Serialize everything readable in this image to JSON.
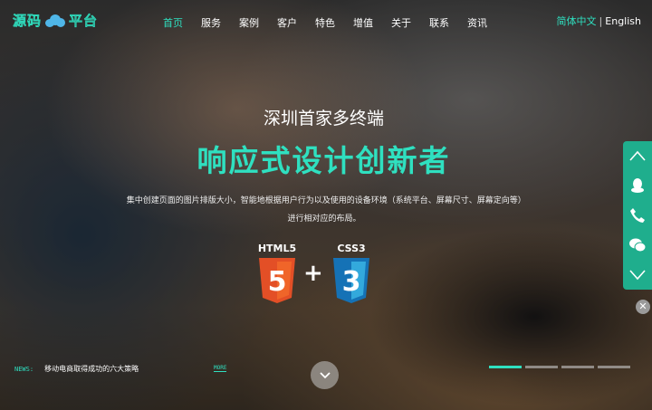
{
  "header": {
    "logo_text_left": "源码",
    "logo_text_right": "平台",
    "nav": [
      {
        "label": "首页",
        "active": true
      },
      {
        "label": "服务",
        "active": false
      },
      {
        "label": "案例",
        "active": false
      },
      {
        "label": "客户",
        "active": false
      },
      {
        "label": "特色",
        "active": false
      },
      {
        "label": "增值",
        "active": false
      },
      {
        "label": "关于",
        "active": false
      },
      {
        "label": "联系",
        "active": false
      },
      {
        "label": "资讯",
        "active": false
      }
    ],
    "lang": {
      "zh": "简体中文",
      "sep": "|",
      "en": "English"
    }
  },
  "hero": {
    "subtitle": "深圳首家多终端",
    "title": "响应式设计创新者",
    "description": "集中创建页面的图片排版大小，智能地根据用户行为以及使用的设备环境（系统平台、屏幕尺寸、屏幕定向等）进行相对应的布局。",
    "html5": {
      "label": "HTML5",
      "glyph": "5",
      "color": "#e34f26"
    },
    "plus": "+",
    "css3": {
      "label": "CSS3",
      "glyph": "3",
      "color": "#1572b6"
    }
  },
  "sidebar": {
    "icons": [
      "chevron-up-icon",
      "qq-icon",
      "phone-icon",
      "wechat-icon",
      "chevron-down-icon"
    ],
    "color": "#1fae8d",
    "close": "✕"
  },
  "news": {
    "label": "NEWS:",
    "text": "移动电商取得成功的六大策略",
    "more": "MORE"
  },
  "accent": "#2fe0c0",
  "slides": {
    "count": 4,
    "active": 0
  }
}
